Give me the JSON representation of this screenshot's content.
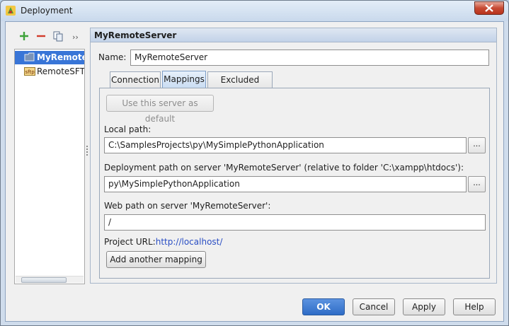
{
  "window": {
    "title": "Deployment"
  },
  "toolbar": {
    "add_icon": "plus-icon",
    "remove_icon": "minus-icon",
    "copy_icon": "copy-icon",
    "more_label": "››"
  },
  "servers": {
    "items": [
      {
        "label": "MyRemoteServer",
        "icon": "folder-server-icon",
        "selected": true
      },
      {
        "label": "RemoteSFTP",
        "icon": "sftp-icon",
        "selected": false
      }
    ]
  },
  "panel": {
    "header_title": "MyRemoteServer",
    "name_label": "Name:",
    "name_value": "MyRemoteServer"
  },
  "tabs": [
    {
      "label": "Connection",
      "active": false
    },
    {
      "label": "Mappings",
      "active": true
    },
    {
      "label": "Excluded Paths",
      "active": false
    }
  ],
  "mappings": {
    "default_button": "Use this server as default",
    "local_path_label": "Local path:",
    "local_path_value": "C:\\SamplesProjects\\py\\MySimplePythonApplication",
    "deploy_path_label": "Deployment path on server 'MyRemoteServer' (relative to folder 'C:\\xampp\\htdocs'):",
    "deploy_path_value": "py\\MySimplePythonApplication",
    "web_path_label": "Web path on server 'MyRemoteServer':",
    "web_path_value": "/",
    "project_url_label": "Project URL:",
    "project_url_value": "http://localhost/",
    "add_mapping_button": "Add another mapping",
    "browse_label": "..."
  },
  "footer": {
    "ok": "OK",
    "cancel": "Cancel",
    "apply": "Apply",
    "help": "Help"
  },
  "colors": {
    "accent": "#3875d7",
    "link": "#2a4ec4"
  }
}
